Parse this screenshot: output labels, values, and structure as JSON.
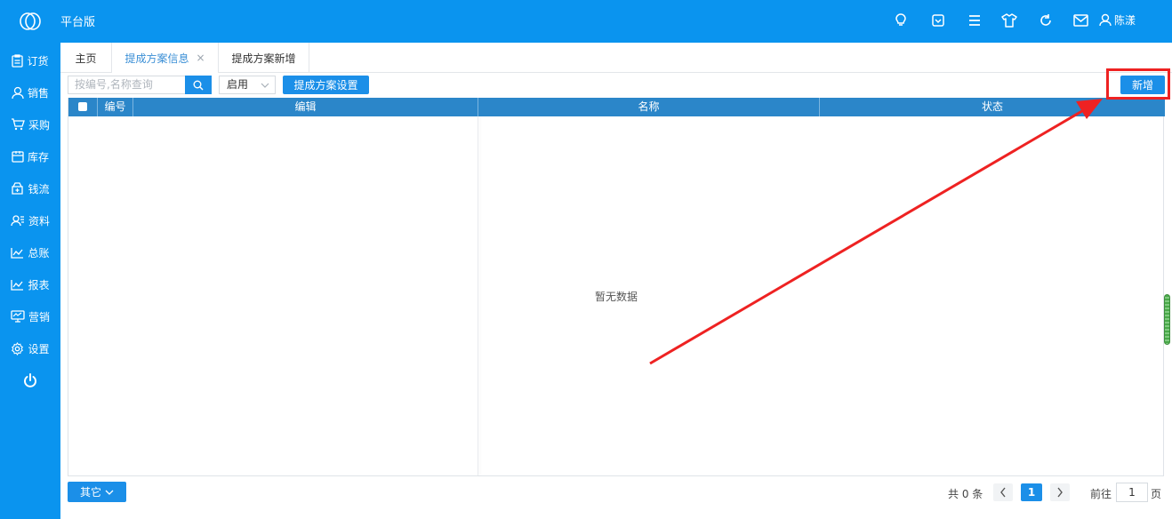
{
  "header": {
    "app_name": "平台版",
    "user_name": "陈漾",
    "icons": [
      "logo-icon",
      "lightbulb-icon",
      "dropdown-box-icon",
      "menu-icon",
      "shirt-icon",
      "refresh-icon",
      "mail-icon",
      "user-icon"
    ]
  },
  "sidebar": {
    "items": [
      {
        "label": "订货",
        "icon": "clipboard-icon"
      },
      {
        "label": "销售",
        "icon": "person-icon"
      },
      {
        "label": "采购",
        "icon": "cart-icon"
      },
      {
        "label": "库存",
        "icon": "box-icon"
      },
      {
        "label": "钱流",
        "icon": "wallet-icon"
      },
      {
        "label": "资料",
        "icon": "contacts-icon"
      },
      {
        "label": "总账",
        "icon": "chart-icon"
      },
      {
        "label": "报表",
        "icon": "report-icon"
      },
      {
        "label": "营销",
        "icon": "monitor-icon"
      },
      {
        "label": "设置",
        "icon": "gear-icon"
      }
    ],
    "power_icon": "power-icon"
  },
  "tabs": [
    {
      "label": "主页",
      "active": false
    },
    {
      "label": "提成方案信息",
      "active": true,
      "close": "×"
    },
    {
      "label": "提成方案新增",
      "active": false
    }
  ],
  "toolbar": {
    "search_placeholder": "按编号,名称查询",
    "status_select": "启用",
    "settings_button": "提成方案设置",
    "add_button": "新增"
  },
  "table": {
    "columns": [
      "编号",
      "编辑",
      "名称",
      "状态"
    ],
    "empty_text": "暂无数据"
  },
  "footer": {
    "other_button": "其它",
    "total_text": "共 0 条",
    "current_page": "1",
    "goto_label": "前往",
    "goto_value": "1",
    "page_suffix": "页"
  },
  "colors": {
    "primary": "#0a94ef",
    "header_row": "#2b86c9",
    "annotation": "#ee2222"
  }
}
